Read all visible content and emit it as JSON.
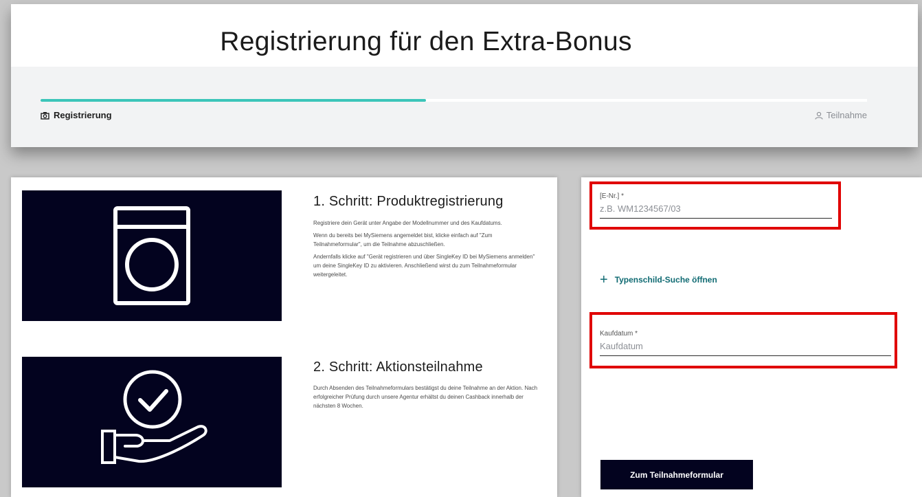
{
  "header": {
    "title": "Registrierung für den Extra-Bonus",
    "progress_fraction": 0.466,
    "steps": {
      "current": "Registrierung",
      "next": "Teilnahme"
    },
    "icons": {
      "current": "camera-icon",
      "next": "user-icon"
    }
  },
  "steps": [
    {
      "heading": "1. Schritt: Produktregistrierung",
      "icon": "washing-machine-icon",
      "paragraphs": [
        "Registriere dein Gerät unter Angabe der Modellnummer und des Kaufdatums.",
        "Wenn du bereits bei MySiemens angemeldet bist, klicke einfach auf \"Zum Teilnahmeformular\", um die Teilnahme abzuschließen.",
        "Andernfalls klicke auf \"Gerät registrieren und über SingleKey ID bei MySiemens anmelden\" um deine SingleKey ID zu aktivieren. Anschließend wirst du zum Teilnahmeformular weitergeleitet."
      ]
    },
    {
      "heading": "2. Schritt: Aktionsteilnahme",
      "icon": "hand-checkmark-icon",
      "paragraphs": [
        "Durch Absenden des Teilnahmeformulars bestätigst du deine Teilnahme an der Aktion. Nach erfolgreicher Prüfung durch unsere Agentur erhältst du deinen Cashback innerhalb der nächsten 8 Wochen."
      ]
    }
  ],
  "form": {
    "enr": {
      "label": "[E-Nr.] *",
      "placeholder": "z.B. WM1234567/03",
      "value": ""
    },
    "type_search_link": "Typenschild-Suche öffnen",
    "kaufdatum": {
      "label": "Kaufdatum *",
      "placeholder": "Kaufdatum",
      "value": ""
    },
    "submit_label": "Zum Teilnahmeformular"
  },
  "colors": {
    "accent": "#3cc5b9",
    "dark_navy": "#03031f",
    "link": "#0f6a72",
    "highlight": "#e00000"
  }
}
